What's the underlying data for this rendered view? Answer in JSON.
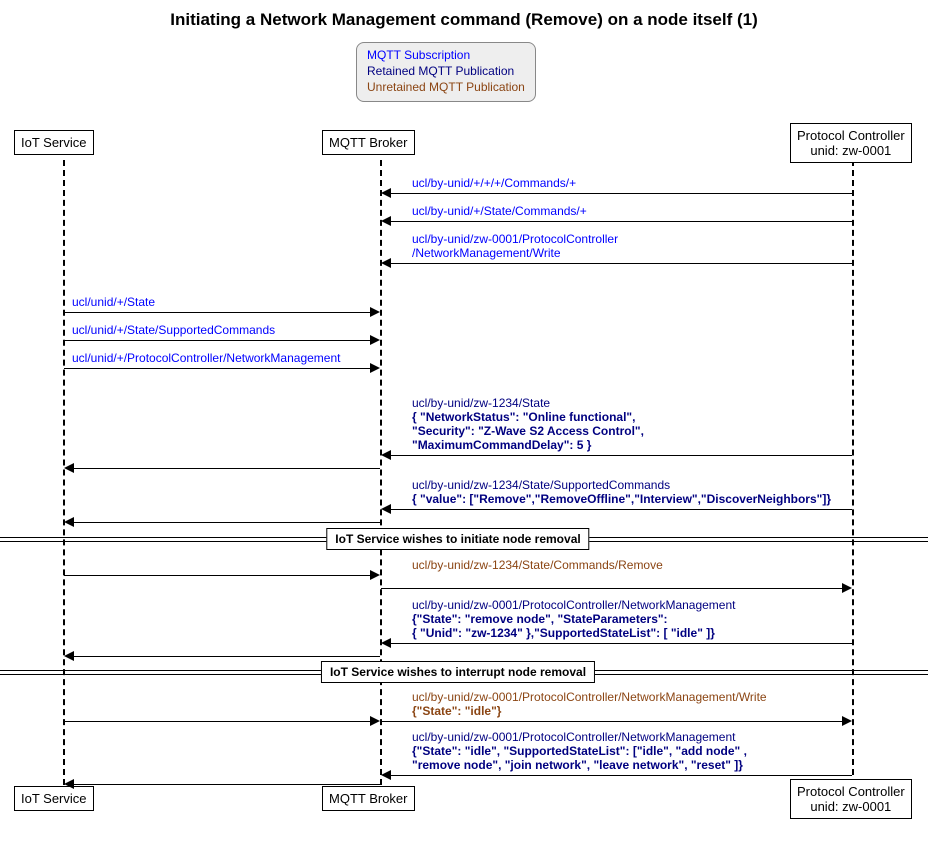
{
  "title": "Initiating a Network Management command (Remove) on a node itself (1)",
  "legend": {
    "l1": "MQTT Subscription",
    "l2": "Retained MQTT Publication",
    "l3": "Unretained MQTT Publication"
  },
  "participants": {
    "iot": "IoT Service",
    "broker": "MQTT Broker",
    "pc": "Protocol Controller\nunid: zw-0001"
  },
  "msgs": {
    "m1": "ucl/by-unid/+/+/+/Commands/+",
    "m2": "ucl/by-unid/+/State/Commands/+",
    "m3a": "ucl/by-unid/zw-0001/ProtocolController",
    "m3b": "/NetworkManagement/Write",
    "m4": "ucl/unid/+/State",
    "m5": "ucl/unid/+/State/SupportedCommands",
    "m6": "ucl/unid/+/ProtocolController/NetworkManagement",
    "m7a": "ucl/by-unid/zw-1234/State",
    "m7b": "{ \"NetworkStatus\": \"Online functional\",",
    "m7c": "\"Security\": \"Z-Wave S2 Access Control\",",
    "m7d": "\"MaximumCommandDelay\": 5 }",
    "m8a": "ucl/by-unid/zw-1234/State/SupportedCommands",
    "m8b": "{ \"value\": [\"Remove\",\"RemoveOffline\",\"Interview\",\"DiscoverNeighbors\"]}",
    "div1": "IoT Service wishes to initiate node removal",
    "m9": "ucl/by-unid/zw-1234/State/Commands/Remove",
    "m10a": "ucl/by-unid/zw-0001/ProtocolController/NetworkManagement",
    "m10b": "{\"State\": \"remove node\", \"StateParameters\":",
    "m10c": "{ \"Unid\": \"zw-1234\" },\"SupportedStateList\": [ \"idle\" ]}",
    "div2": "IoT Service wishes to interrupt node removal",
    "m11a": "ucl/by-unid/zw-0001/ProtocolController/NetworkManagement/Write",
    "m11b": "{\"State\": \"idle\"}",
    "m12a": "ucl/by-unid/zw-0001/ProtocolController/NetworkManagement",
    "m12b": "{\"State\": \"idle\", \"SupportedStateList\":  [\"idle\", \"add node\" ,",
    "m12c": " \"remove node\", \"join network\", \"leave network\", \"reset\" ]}"
  }
}
